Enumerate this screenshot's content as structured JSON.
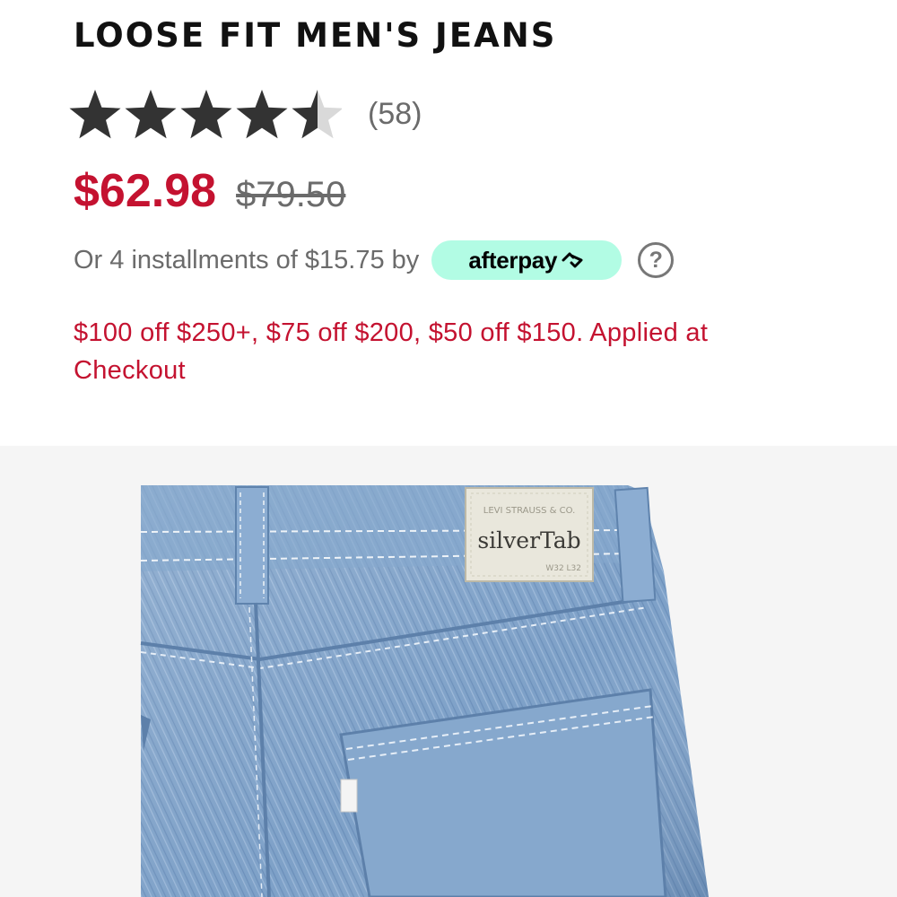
{
  "product": {
    "title": "LOOSE FIT MEN'S JEANS",
    "rating": 4.5,
    "rating_max": 5,
    "review_count": "(58)",
    "sale_price": "$62.98",
    "original_price": "$79.50",
    "installments_text": "Or 4 installments of $15.75 by",
    "afterpay_label": "afterpay",
    "help_icon": "?",
    "promo_text": "$100 off $250+, $75 off $200, $50 off $150. Applied at Checkout"
  },
  "image": {
    "icon": "jeans-back-photo",
    "patch_line1": "LEVI STRAUSS & CO.",
    "patch_brand": "silverTab",
    "patch_size": "W32  L32"
  },
  "colors": {
    "accent_red": "#c41230",
    "star_filled": "#333333",
    "star_empty": "#d9d9d9",
    "afterpay_mint": "#b2fce4",
    "denim": "#7fa2c9"
  }
}
